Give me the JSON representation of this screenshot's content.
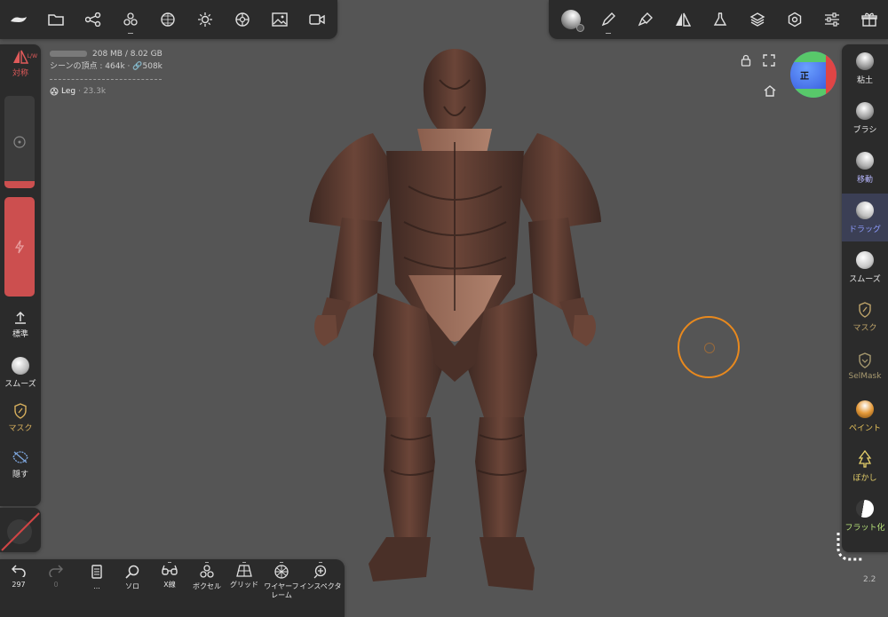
{
  "info": {
    "memory": "208 MB / 8.02 GB",
    "scene_vertices": "シーンの頂点 : 464k · ",
    "scene_faces": "508k",
    "mesh_name": "Leg",
    "mesh_count": "· 23.3k"
  },
  "top_left_toolbar": [
    "app-menu-icon",
    "folder-icon",
    "scene-graph-icon",
    "voxel-group-icon",
    "sphere-grid-icon",
    "light-icon",
    "environment-icon",
    "background-image-icon",
    "video-camera-icon"
  ],
  "top_right_toolbar": [
    "material-sphere-icon",
    "brush-stroke-icon",
    "paint-icon",
    "symmetry-icon",
    "flask-icon",
    "layers-icon",
    "settings-icon",
    "sliders-icon",
    "gift-icon"
  ],
  "left_sidebar": {
    "symmetry_label": "対称",
    "symmetry_badge": "L/W",
    "standard_label": "標準",
    "smooth_label": "スムーズ",
    "mask_label": "マスク",
    "hide_label": "隠す"
  },
  "bottom_bar": {
    "undo_count": "297",
    "redo_count": "0",
    "doc_label": "...",
    "solo_label": "ソロ",
    "xray_label": "X線",
    "voxel_label": "ボクセル",
    "grid_label": "グリッド",
    "wireframe_label": "ワイヤーフ\nレーム",
    "inspector_label": "インスペクタ"
  },
  "right_sidebar": {
    "clay": "粘土",
    "brush": "ブラシ",
    "move": "移動",
    "drag": "ドラッグ",
    "smooth": "スムーズ",
    "mask": "マスク",
    "selmask": "SelMask",
    "paint": "ペイント",
    "blur": "ぼかし",
    "flatten": "フラット化"
  },
  "gizmo": {
    "label": "正"
  },
  "version": "2.2",
  "colors": {
    "accent_red": "#cc4f4f",
    "active_tool": "#8e9cff",
    "brush_cursor": "#e8891e",
    "mesh": "#5a3a30"
  }
}
